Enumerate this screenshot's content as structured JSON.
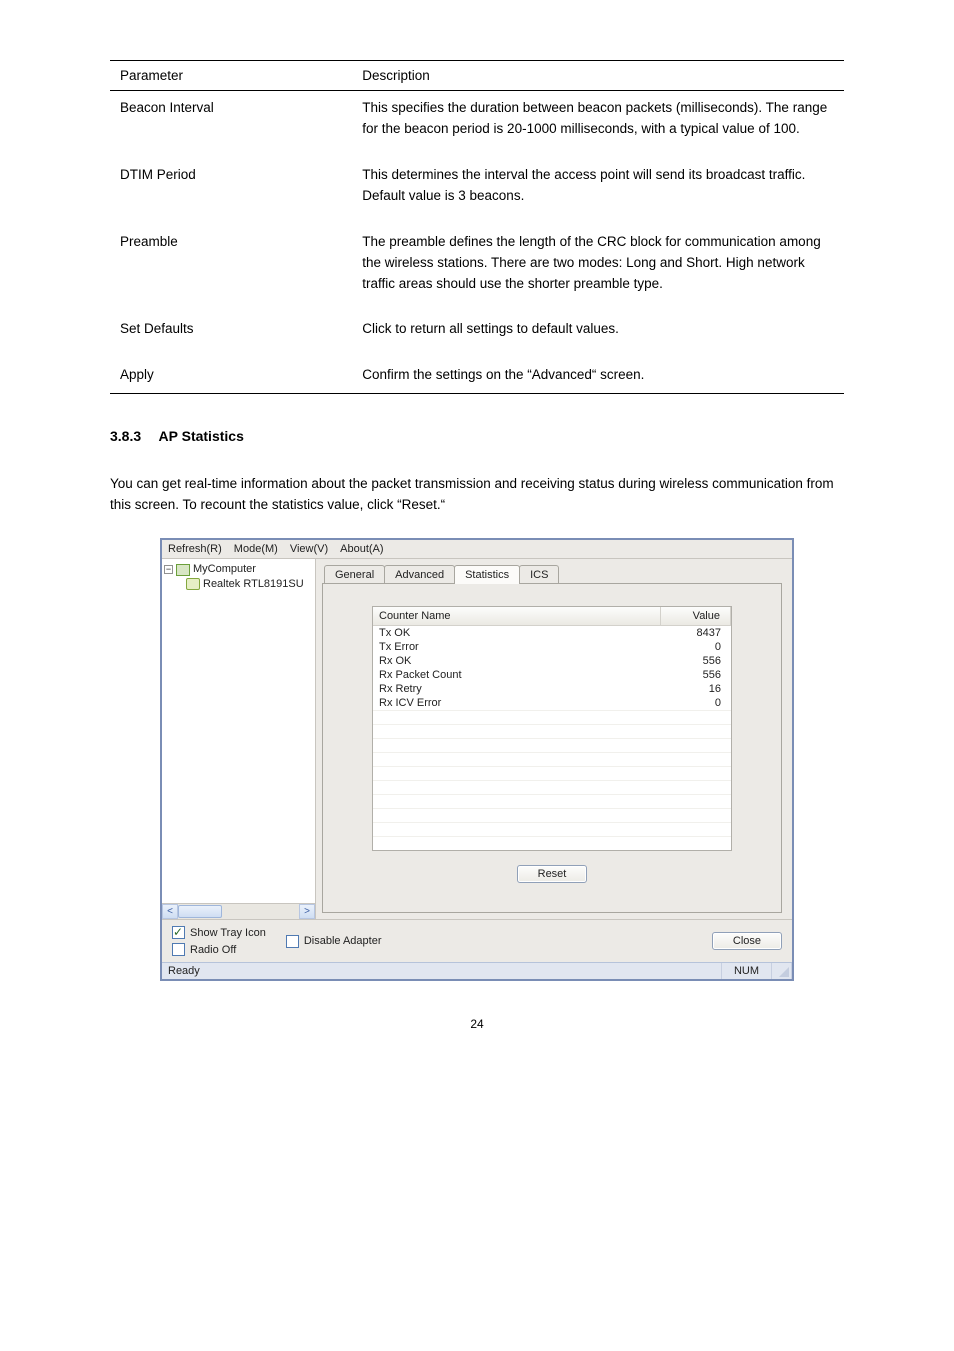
{
  "paramTable": {
    "headers": {
      "param": "Parameter",
      "desc": "Description"
    },
    "rows": [
      {
        "param": "Beacon Interval",
        "desc": "This specifies the duration between beacon packets (milliseconds). The range for the beacon period is 20-1000 milliseconds, with a typical value of 100."
      },
      {
        "param": "DTIM Period",
        "desc": "This determines the interval the access point will send its broadcast traffic. Default value is 3 beacons."
      },
      {
        "param": "Preamble",
        "desc": "The preamble defines the length of the CRC block for communication among the wireless stations. There are two modes: Long and Short. High network traffic areas should use the shorter preamble type."
      },
      {
        "param": "Set Defaults",
        "desc": "Click to return all settings to default values."
      },
      {
        "param": "Apply",
        "desc": "Confirm the settings on the “Advanced“ screen."
      }
    ]
  },
  "section": {
    "number": "3.8.3",
    "title": "AP Statistics"
  },
  "paragraph": "You can get real-time information about the packet transmission and receiving status during wireless communication from this screen. To recount the statistics value, click “Reset.“",
  "appWindow": {
    "menu": {
      "refresh": "Refresh(R)",
      "mode": "Mode(M)",
      "view": "View(V)",
      "about": "About(A)"
    },
    "tree": {
      "root": "MyComputer",
      "child": "Realtek RTL8191SU "
    },
    "tabs": {
      "general": "General",
      "advanced": "Advanced",
      "stats": "Statistics",
      "ics": "ICS"
    },
    "statsHeader": {
      "name": "Counter Name",
      "value": "Value"
    },
    "stats": [
      {
        "name": "Tx OK",
        "value": "8437"
      },
      {
        "name": "Tx Error",
        "value": "0"
      },
      {
        "name": "Rx OK",
        "value": "556"
      },
      {
        "name": "Rx Packet Count",
        "value": "556"
      },
      {
        "name": "Rx Retry",
        "value": "16"
      },
      {
        "name": "Rx ICV Error",
        "value": "0"
      }
    ],
    "buttons": {
      "reset": "Reset",
      "close": "Close"
    },
    "checks": {
      "showTray": "Show Tray Icon",
      "radioOff": "Radio Off",
      "disableAdapter": "Disable Adapter"
    },
    "status": {
      "ready": "Ready",
      "num": "NUM"
    }
  },
  "pageNumber": "24"
}
